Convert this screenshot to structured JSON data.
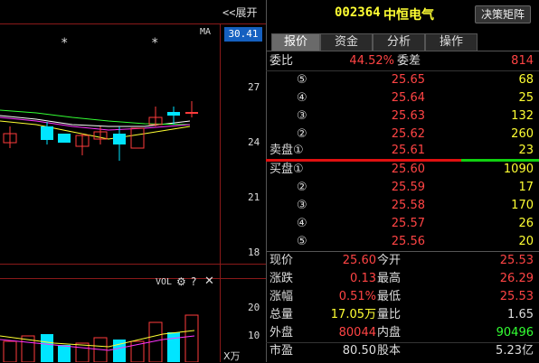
{
  "chart": {
    "expand_label": "<<展开",
    "ma_label": "MA",
    "star_marks": [
      "*",
      "*"
    ],
    "price_badge": "30.41",
    "y_ticks": [
      "27",
      "24",
      "21",
      "18"
    ],
    "vol_label": "VOL",
    "vol_ticks": [
      "20",
      "10"
    ],
    "vol_unit": "X万",
    "colors": {
      "up": "#ff3b3b",
      "down": "#00e5ff",
      "grid": "#8a1a1a"
    }
  },
  "header": {
    "code": "002364",
    "name": "中恒电气",
    "decision_button": "决策矩阵"
  },
  "tabs": [
    {
      "label": "报价",
      "active": true
    },
    {
      "label": "资金",
      "active": false
    },
    {
      "label": "分析",
      "active": false
    },
    {
      "label": "操作",
      "active": false
    }
  ],
  "commission": {
    "ratio_label": "委比",
    "ratio_value": "44.52%",
    "diff_label": "委差",
    "diff_value": "814"
  },
  "sell_orders": [
    {
      "level": "⑤",
      "price": "25.65",
      "volume": "68"
    },
    {
      "level": "④",
      "price": "25.64",
      "volume": "25"
    },
    {
      "level": "③",
      "price": "25.63",
      "volume": "132"
    },
    {
      "level": "②",
      "price": "25.62",
      "volume": "260"
    },
    {
      "level": "卖盘①",
      "price": "25.61",
      "volume": "23"
    }
  ],
  "buy_orders": [
    {
      "level": "买盘①",
      "price": "25.60",
      "volume": "1090"
    },
    {
      "level": "②",
      "price": "25.59",
      "volume": "17"
    },
    {
      "level": "③",
      "price": "25.58",
      "volume": "170"
    },
    {
      "level": "④",
      "price": "25.57",
      "volume": "26"
    },
    {
      "level": "⑤",
      "price": "25.56",
      "volume": "20"
    }
  ],
  "quote": [
    {
      "l1": "现价",
      "v1": "25.60",
      "l2": "今开",
      "v2": "25.53"
    },
    {
      "l1": "涨跌",
      "v1": "0.13",
      "l2": "最高",
      "v2": "26.29"
    },
    {
      "l1": "涨幅",
      "v1": "0.51%",
      "l2": "最低",
      "v2": "25.53"
    },
    {
      "l1": "总量",
      "v1": "17.05万",
      "l2": "量比",
      "v2": "1.65"
    },
    {
      "l1": "外盘",
      "v1": "80044",
      "l2": "内盘",
      "v2": "90496"
    },
    {
      "l1": "市盈",
      "v1": "80.50",
      "l2": "股本",
      "v2": "5.23亿"
    }
  ]
}
